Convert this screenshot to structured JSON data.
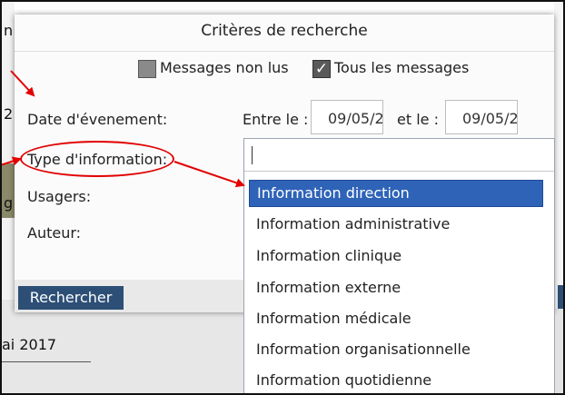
{
  "background": {
    "left_fragment_1": "n",
    "left_fragment_2": "2",
    "left_fragment_3": "g",
    "date_text": "ai 2017"
  },
  "dialog": {
    "title": "Critères de recherche",
    "checkboxes": [
      {
        "label": "Messages non lus",
        "checked": false
      },
      {
        "label": "Tous les messages",
        "checked": true
      }
    ],
    "fields": {
      "date_label": "Date d'évenement:",
      "between_label": "Entre le :",
      "date_from": "09/05/2",
      "and_label": "et le :",
      "date_to": "09/05/2",
      "type_label": "Type d'information:",
      "users_label": "Usagers:",
      "author_label": "Auteur:"
    },
    "search_button": "Rechercher"
  },
  "dropdown": {
    "input_value": "",
    "options": [
      "Information direction",
      "Information administrative",
      "Information clinique",
      "Information externe",
      "Information médicale",
      "Information organisationnelle",
      "Information quotidienne"
    ],
    "selected_index": 0
  },
  "colors": {
    "selection": "#2e63b8",
    "button": "#2d4f76",
    "annotation": "#e20000"
  }
}
